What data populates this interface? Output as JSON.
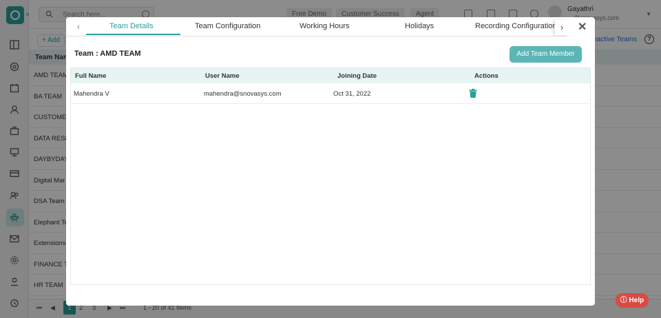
{
  "app": {
    "search_placeholder": "Search here...",
    "topbar_buttons": [
      "Free Demo",
      "Customer Success",
      "Agent"
    ],
    "user": {
      "name": "Gayathri",
      "email": "…@snovasys.com"
    },
    "add_label": "Add",
    "inactive_teams_label": "Inactive Teams",
    "list_header": "Team Nam",
    "teams": [
      "AMD TEAM",
      "BA TEAM",
      "CUSTOMER",
      "DATA RESEA",
      "DAYBYDAY",
      "Digital Mar",
      "DSA Team",
      "Elephant Te",
      "Extensions",
      "FINANCE TE",
      "HR TEAM"
    ],
    "pager": {
      "pages": [
        "1",
        "2",
        "3"
      ],
      "summary": "1 - 20 of 41 Items"
    },
    "help_label": "Help"
  },
  "modal": {
    "tabs": [
      "Team Details",
      "Team Configuration",
      "Working Hours",
      "Holidays",
      "Recording Configuration"
    ],
    "active_tab": "Team Details",
    "team_label": "Team :",
    "team_name": "AMD TEAM",
    "add_member_label": "Add Team Member",
    "table": {
      "headers": [
        "Full Name",
        "User Name",
        "Joining Date",
        "Actions"
      ],
      "rows": [
        {
          "full_name": "Mahendra V",
          "user_name": "mahendra@snovasys.com",
          "joining_date": "Oct 31, 2022"
        }
      ]
    }
  },
  "colors": {
    "accent": "#2a9d9b",
    "button": "#5bb6b6",
    "help": "#d94a43"
  }
}
